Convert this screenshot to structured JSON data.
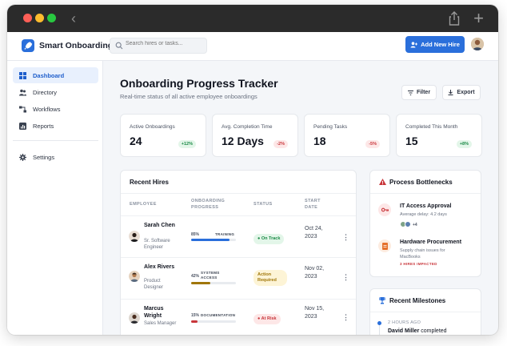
{
  "app": {
    "name": "Smart Onboarding",
    "search_placeholder": "Search hires or tasks...",
    "add_button": "Add New Hire"
  },
  "sidebar": {
    "items": [
      {
        "label": "Dashboard",
        "icon": "grid-icon",
        "active": true
      },
      {
        "label": "Directory",
        "icon": "users-icon"
      },
      {
        "label": "Workflows",
        "icon": "workflow-icon"
      },
      {
        "label": "Reports",
        "icon": "chart-icon"
      }
    ],
    "settings": "Settings"
  },
  "page": {
    "title": "Onboarding Progress Tracker",
    "subtitle": "Real-time status of all active employee onboardings",
    "filter_label": "Filter",
    "export_label": "Export"
  },
  "stats": [
    {
      "label": "Active Onboardings",
      "value": "24",
      "badge": "+12%",
      "trend": "up"
    },
    {
      "label": "Avg. Completion Time",
      "value": "12 Days",
      "badge": "-2%",
      "trend": "down"
    },
    {
      "label": "Pending Tasks",
      "value": "18",
      "badge": "-5%",
      "trend": "down"
    },
    {
      "label": "Completed This Month",
      "value": "15",
      "badge": "+8%",
      "trend": "up"
    }
  ],
  "recent_hires": {
    "title": "Recent Hires",
    "headers": {
      "employee": "EMPLOYEE",
      "progress": "ONBOARDING PROGRESS",
      "status": "STATUS",
      "start": "START DATE"
    },
    "rows": [
      {
        "name": "Sarah Chen",
        "role": "Sr. Software Engineer",
        "progress": 85,
        "progress_label": "85%",
        "stage": "TRAINING",
        "status": "On Track",
        "status_kind": "green",
        "start": "Oct 24, 2023"
      },
      {
        "name": "Alex Rivers",
        "role": "Product Designer",
        "progress": 42,
        "progress_label": "42%",
        "stage": "SYSTEMS ACCESS",
        "status": "Action Required",
        "status_kind": "yellow",
        "start": "Nov 02, 2023"
      },
      {
        "name": "Marcus Wright",
        "role": "Sales Manager",
        "progress": 15,
        "progress_label": "15%",
        "stage": "DOCUMENTATION",
        "status": "At Risk",
        "status_kind": "red",
        "start": "Nov 15, 2023"
      }
    ]
  },
  "bottlenecks": {
    "title": "Process Bottlenecks",
    "items": [
      {
        "title": "IT Access Approval",
        "sub": "Average delay: 4.2 days",
        "extra_count": "+4"
      },
      {
        "title": "Hardware Procurement",
        "sub": "Supply chain issues for MacBooks",
        "tag": "3 HIRES IMPACTED"
      }
    ]
  },
  "milestones": {
    "title": "Recent Milestones",
    "items": [
      {
        "time": "2 HOURS AGO",
        "name": "David Miller",
        "text": "completed"
      }
    ]
  },
  "colors": {
    "accent": "#2a6fdb",
    "green": "#1b8a47",
    "red": "#c8353a",
    "yellow": "#a07608"
  }
}
